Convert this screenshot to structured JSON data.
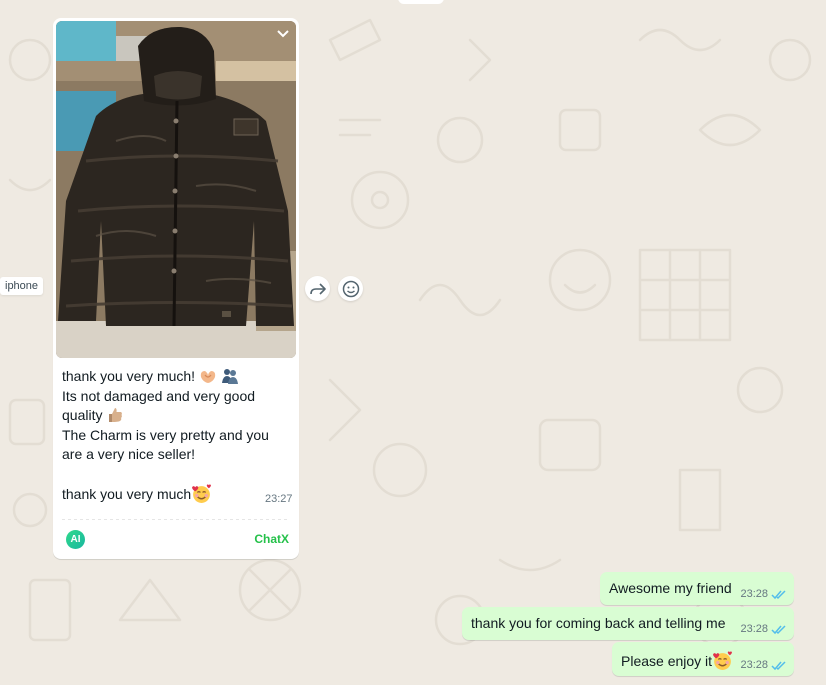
{
  "colors": {
    "chat_background": "#efeae2",
    "incoming_bubble": "#ffffff",
    "outgoing_bubble": "#d9fdd3",
    "read_ticks": "#53bdeb",
    "chatx_brand": "#25c14a"
  },
  "sender_tag": "iphone",
  "incoming_message": {
    "image_description_icon": "puffer-jacket-photo",
    "lines": [
      "thank you very much!",
      "Its not damaged and very good",
      "quality",
      "The Charm is very pretty and you",
      "are a very nice seller!",
      "thank you very much"
    ],
    "emojis": [
      "heart-hands-emoji",
      "people-emoji",
      "thumbs-up-emoji",
      "smiling-face-with-hearts-emoji"
    ],
    "time": "23:27",
    "ai_badge": "AI",
    "addon_label": "ChatX"
  },
  "actions": {
    "forward_icon": "forward-icon",
    "react_icon": "emoji-react-icon",
    "menu_icon": "chevron-down-icon"
  },
  "outgoing_messages": [
    {
      "text": "Awesome my friend",
      "time": "23:28",
      "status": "read"
    },
    {
      "text": "thank you for coming back and telling me",
      "time": "23:28",
      "status": "read"
    },
    {
      "text": "Please enjoy it",
      "time": "23:28",
      "status": "read",
      "emoji": "smiling-face-with-hearts-emoji"
    }
  ]
}
